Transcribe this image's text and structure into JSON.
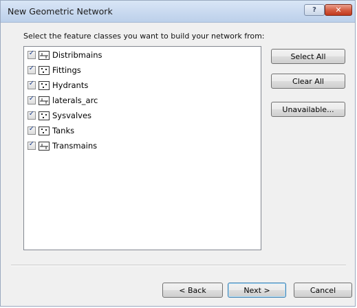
{
  "window": {
    "title": "New Geometric Network",
    "help_label": "?",
    "close_label": "✕"
  },
  "instruction": "Select the feature classes you want to build your network from:",
  "feature_classes": [
    {
      "label": "Distribmains",
      "checked": true,
      "icon": "line-feature-class-icon"
    },
    {
      "label": "Fittings",
      "checked": true,
      "icon": "point-feature-class-icon"
    },
    {
      "label": "Hydrants",
      "checked": true,
      "icon": "point-feature-class-icon"
    },
    {
      "label": "laterals_arc",
      "checked": true,
      "icon": "line-feature-class-icon"
    },
    {
      "label": "Sysvalves",
      "checked": true,
      "icon": "point-feature-class-icon"
    },
    {
      "label": "Tanks",
      "checked": true,
      "icon": "point-feature-class-icon"
    },
    {
      "label": "Transmains",
      "checked": true,
      "icon": "line-feature-class-icon"
    }
  ],
  "check_mark": "✓",
  "side_buttons": {
    "select_all": "Select All",
    "clear_all": "Clear All",
    "unavailable": "Unavailable..."
  },
  "footer_buttons": {
    "back": "< Back",
    "next": "Next >",
    "cancel": "Cancel"
  }
}
